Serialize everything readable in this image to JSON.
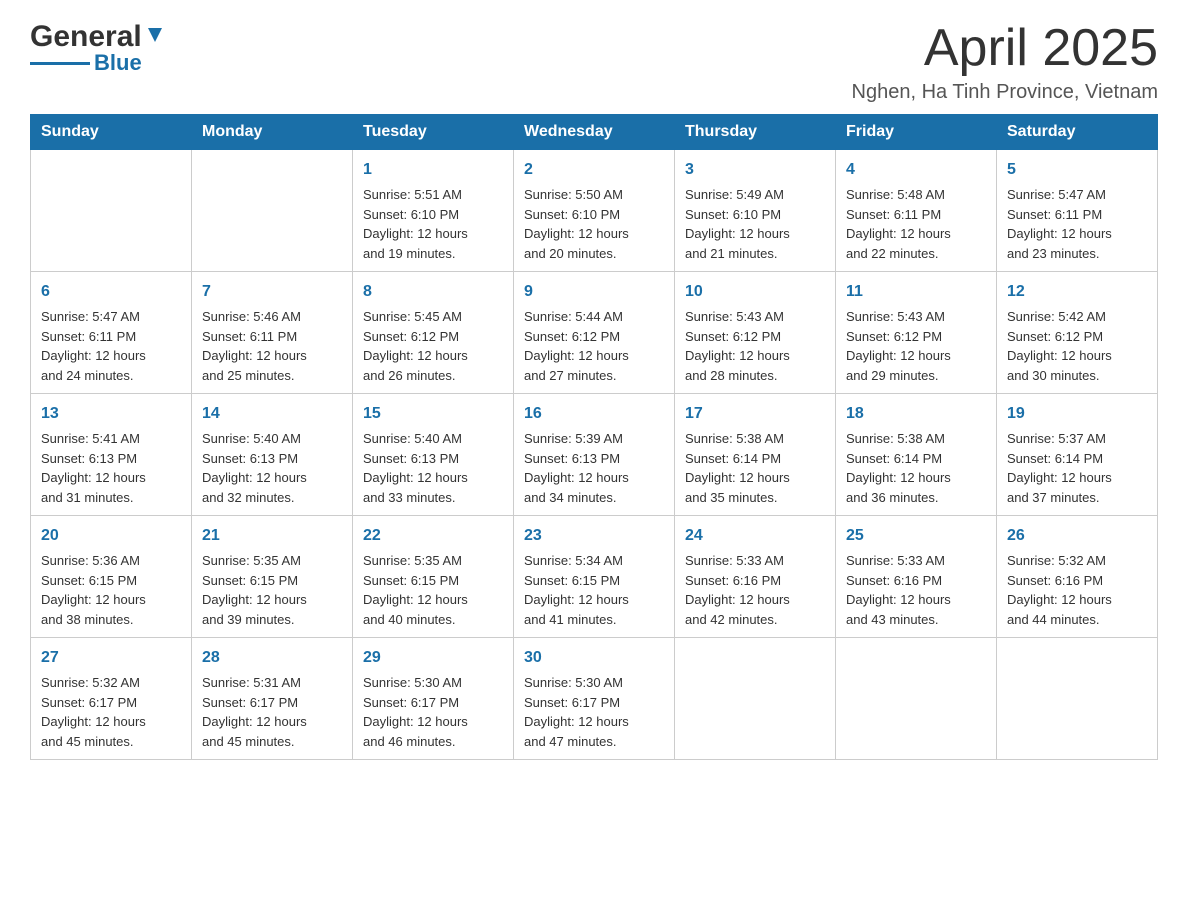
{
  "header": {
    "month_title": "April 2025",
    "location": "Nghen, Ha Tinh Province, Vietnam",
    "logo_general": "General",
    "logo_blue": "Blue"
  },
  "weekdays": [
    "Sunday",
    "Monday",
    "Tuesday",
    "Wednesday",
    "Thursday",
    "Friday",
    "Saturday"
  ],
  "weeks": [
    [
      {
        "day": "",
        "info": ""
      },
      {
        "day": "",
        "info": ""
      },
      {
        "day": "1",
        "info": "Sunrise: 5:51 AM\nSunset: 6:10 PM\nDaylight: 12 hours\nand 19 minutes."
      },
      {
        "day": "2",
        "info": "Sunrise: 5:50 AM\nSunset: 6:10 PM\nDaylight: 12 hours\nand 20 minutes."
      },
      {
        "day": "3",
        "info": "Sunrise: 5:49 AM\nSunset: 6:10 PM\nDaylight: 12 hours\nand 21 minutes."
      },
      {
        "day": "4",
        "info": "Sunrise: 5:48 AM\nSunset: 6:11 PM\nDaylight: 12 hours\nand 22 minutes."
      },
      {
        "day": "5",
        "info": "Sunrise: 5:47 AM\nSunset: 6:11 PM\nDaylight: 12 hours\nand 23 minutes."
      }
    ],
    [
      {
        "day": "6",
        "info": "Sunrise: 5:47 AM\nSunset: 6:11 PM\nDaylight: 12 hours\nand 24 minutes."
      },
      {
        "day": "7",
        "info": "Sunrise: 5:46 AM\nSunset: 6:11 PM\nDaylight: 12 hours\nand 25 minutes."
      },
      {
        "day": "8",
        "info": "Sunrise: 5:45 AM\nSunset: 6:12 PM\nDaylight: 12 hours\nand 26 minutes."
      },
      {
        "day": "9",
        "info": "Sunrise: 5:44 AM\nSunset: 6:12 PM\nDaylight: 12 hours\nand 27 minutes."
      },
      {
        "day": "10",
        "info": "Sunrise: 5:43 AM\nSunset: 6:12 PM\nDaylight: 12 hours\nand 28 minutes."
      },
      {
        "day": "11",
        "info": "Sunrise: 5:43 AM\nSunset: 6:12 PM\nDaylight: 12 hours\nand 29 minutes."
      },
      {
        "day": "12",
        "info": "Sunrise: 5:42 AM\nSunset: 6:12 PM\nDaylight: 12 hours\nand 30 minutes."
      }
    ],
    [
      {
        "day": "13",
        "info": "Sunrise: 5:41 AM\nSunset: 6:13 PM\nDaylight: 12 hours\nand 31 minutes."
      },
      {
        "day": "14",
        "info": "Sunrise: 5:40 AM\nSunset: 6:13 PM\nDaylight: 12 hours\nand 32 minutes."
      },
      {
        "day": "15",
        "info": "Sunrise: 5:40 AM\nSunset: 6:13 PM\nDaylight: 12 hours\nand 33 minutes."
      },
      {
        "day": "16",
        "info": "Sunrise: 5:39 AM\nSunset: 6:13 PM\nDaylight: 12 hours\nand 34 minutes."
      },
      {
        "day": "17",
        "info": "Sunrise: 5:38 AM\nSunset: 6:14 PM\nDaylight: 12 hours\nand 35 minutes."
      },
      {
        "day": "18",
        "info": "Sunrise: 5:38 AM\nSunset: 6:14 PM\nDaylight: 12 hours\nand 36 minutes."
      },
      {
        "day": "19",
        "info": "Sunrise: 5:37 AM\nSunset: 6:14 PM\nDaylight: 12 hours\nand 37 minutes."
      }
    ],
    [
      {
        "day": "20",
        "info": "Sunrise: 5:36 AM\nSunset: 6:15 PM\nDaylight: 12 hours\nand 38 minutes."
      },
      {
        "day": "21",
        "info": "Sunrise: 5:35 AM\nSunset: 6:15 PM\nDaylight: 12 hours\nand 39 minutes."
      },
      {
        "day": "22",
        "info": "Sunrise: 5:35 AM\nSunset: 6:15 PM\nDaylight: 12 hours\nand 40 minutes."
      },
      {
        "day": "23",
        "info": "Sunrise: 5:34 AM\nSunset: 6:15 PM\nDaylight: 12 hours\nand 41 minutes."
      },
      {
        "day": "24",
        "info": "Sunrise: 5:33 AM\nSunset: 6:16 PM\nDaylight: 12 hours\nand 42 minutes."
      },
      {
        "day": "25",
        "info": "Sunrise: 5:33 AM\nSunset: 6:16 PM\nDaylight: 12 hours\nand 43 minutes."
      },
      {
        "day": "26",
        "info": "Sunrise: 5:32 AM\nSunset: 6:16 PM\nDaylight: 12 hours\nand 44 minutes."
      }
    ],
    [
      {
        "day": "27",
        "info": "Sunrise: 5:32 AM\nSunset: 6:17 PM\nDaylight: 12 hours\nand 45 minutes."
      },
      {
        "day": "28",
        "info": "Sunrise: 5:31 AM\nSunset: 6:17 PM\nDaylight: 12 hours\nand 45 minutes."
      },
      {
        "day": "29",
        "info": "Sunrise: 5:30 AM\nSunset: 6:17 PM\nDaylight: 12 hours\nand 46 minutes."
      },
      {
        "day": "30",
        "info": "Sunrise: 5:30 AM\nSunset: 6:17 PM\nDaylight: 12 hours\nand 47 minutes."
      },
      {
        "day": "",
        "info": ""
      },
      {
        "day": "",
        "info": ""
      },
      {
        "day": "",
        "info": ""
      }
    ]
  ]
}
